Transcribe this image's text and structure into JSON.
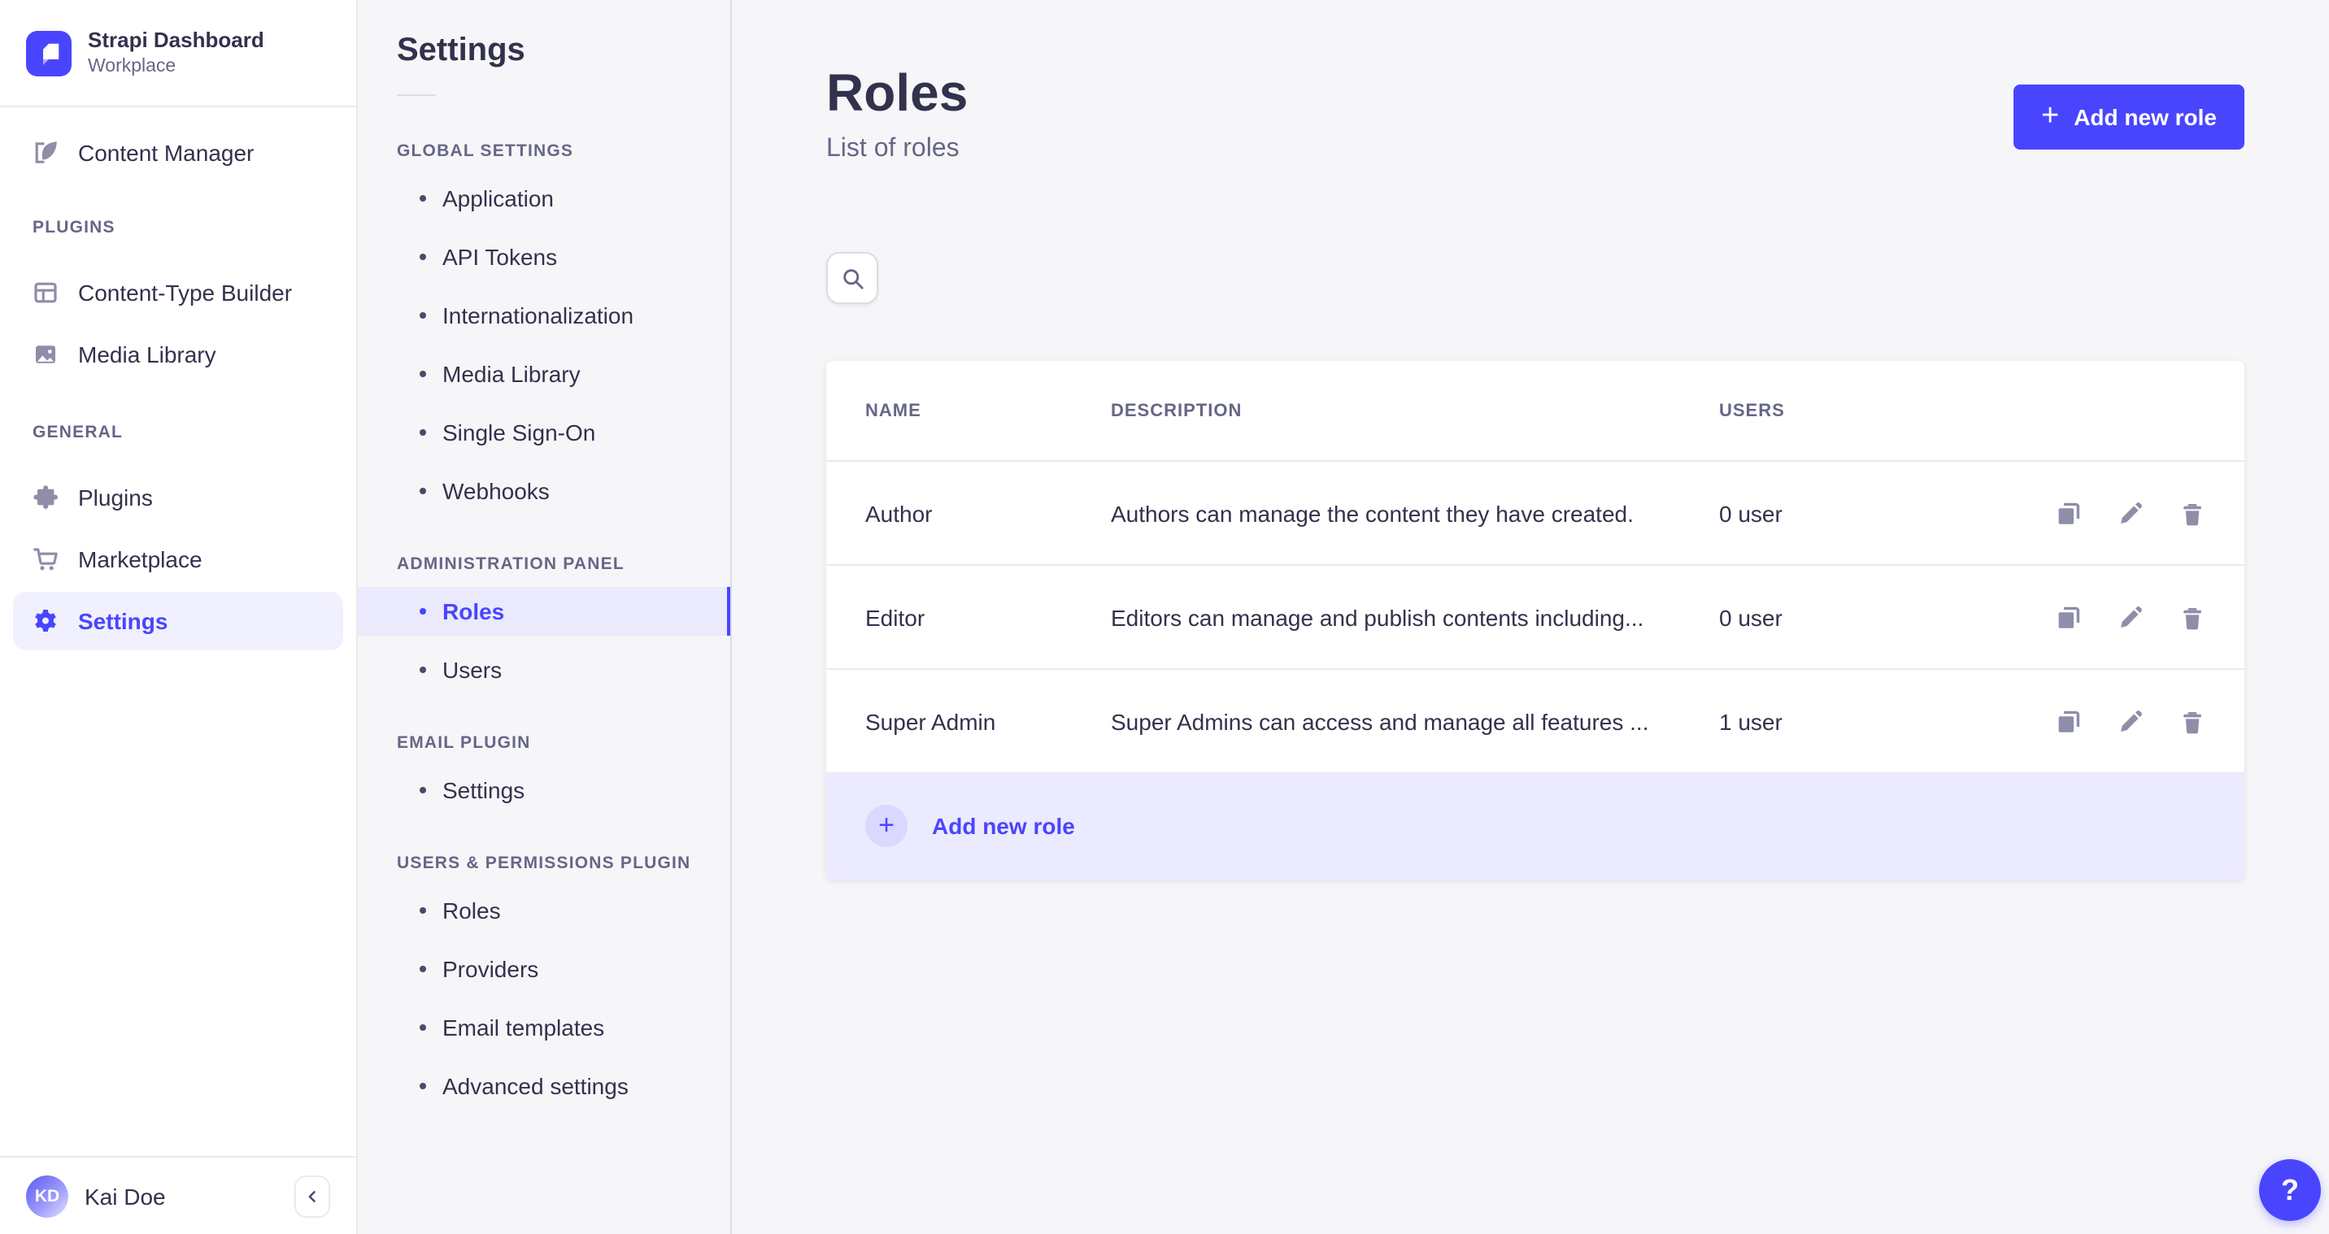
{
  "brand": {
    "name": "Strapi Dashboard",
    "workspace": "Workplace"
  },
  "sidebar": {
    "content_manager": "Content Manager",
    "plugins_section": {
      "label": "PLUGINS",
      "items": {
        "ctb": "Content-Type Builder",
        "media": "Media Library"
      }
    },
    "general_section": {
      "label": "GENERAL",
      "items": {
        "plugins": "Plugins",
        "marketplace": "Marketplace",
        "settings": "Settings"
      }
    },
    "user": {
      "initials": "KD",
      "name": "Kai Doe"
    }
  },
  "subnav": {
    "title": "Settings",
    "global": {
      "label": "GLOBAL SETTINGS",
      "items": [
        "Application",
        "API Tokens",
        "Internationalization",
        "Media Library",
        "Single Sign-On",
        "Webhooks"
      ]
    },
    "admin": {
      "label": "ADMINISTRATION PANEL",
      "items": [
        "Roles",
        "Users"
      ]
    },
    "email": {
      "label": "EMAIL PLUGIN",
      "items": [
        "Settings"
      ]
    },
    "uperm": {
      "label": "USERS & PERMISSIONS PLUGIN",
      "items": [
        "Roles",
        "Providers",
        "Email templates",
        "Advanced settings"
      ]
    }
  },
  "page": {
    "title": "Roles",
    "subtitle": "List of roles",
    "add_button_label": "Add new role"
  },
  "table": {
    "headers": {
      "name": "NAME",
      "description": "DESCRIPTION",
      "users": "USERS"
    },
    "rows": [
      {
        "name": "Author",
        "description": "Authors can manage the content they have created.",
        "users": "0 user"
      },
      {
        "name": "Editor",
        "description": "Editors can manage and publish contents including...",
        "users": "0 user"
      },
      {
        "name": "Super Admin",
        "description": "Super Admins can access and manage all features ...",
        "users": "1 user"
      }
    ],
    "footer_action": "Add new role"
  },
  "icons": {
    "plus": "+",
    "question": "?"
  },
  "colors": {
    "accent": "#4945ff",
    "accent_light_bg": "#f0f0ff",
    "footer_bg": "#eceafe",
    "text": "#32324d",
    "muted": "#666687",
    "icon_gray": "#8e8ea9",
    "border": "#eaeaef"
  }
}
